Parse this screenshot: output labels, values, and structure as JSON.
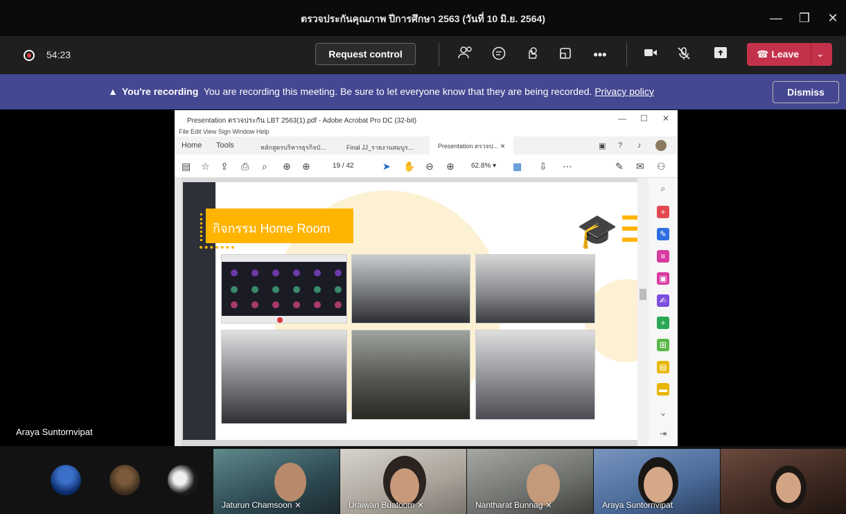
{
  "window": {
    "title": "ตรวจประกันคุณภาพ ปีการศึกษา 2563 (วันที่ 10 มิ.ย. 2564)",
    "minimize": "—",
    "restore": "❐",
    "close": "✕"
  },
  "toolbar": {
    "timer": "54:23",
    "request_control": "Request control",
    "leave": "Leave",
    "icons": [
      "participants-icon",
      "chat-icon",
      "reactions-icon",
      "rooms-icon",
      "more-icon",
      "camera-icon",
      "mic-muted-icon",
      "share-icon"
    ]
  },
  "banner": {
    "bold": "You're recording",
    "text": "You are recording this meeting. Be sure to let everyone know that they are being recorded.",
    "link": "Privacy policy",
    "dismiss": "Dismiss"
  },
  "stage": {
    "presenter_name": "Araya Suntornvipat"
  },
  "acrobat": {
    "title": "Presentation ตรวจประกัน LBT 2563(1).pdf - Adobe Acrobat Pro DC (32-bit)",
    "menu": "File  Edit  View  Sign  Window  Help",
    "home_tab": "Home",
    "tools_tab": "Tools",
    "doc_tabs": [
      "หลักสูตรบริหารธุรกิจบั...",
      "Final JJ_รายงานสมบูร...",
      "Presentation ตรวจป..."
    ],
    "page_current": "19",
    "page_total": "/ 42",
    "zoom": "62.8%",
    "slide_title": "กิจกรรม Home Room"
  },
  "participants": [
    {
      "name": "Jaturun Chamsoon",
      "muted": true
    },
    {
      "name": "Uraiwan Buatoom",
      "muted": true
    },
    {
      "name": "Nantharat Bunnag",
      "muted": true
    },
    {
      "name": "Araya Suntornvipat",
      "muted": false
    }
  ],
  "colors": {
    "leave": "#c4314b",
    "banner": "#444791",
    "accent": "#ffb400"
  }
}
